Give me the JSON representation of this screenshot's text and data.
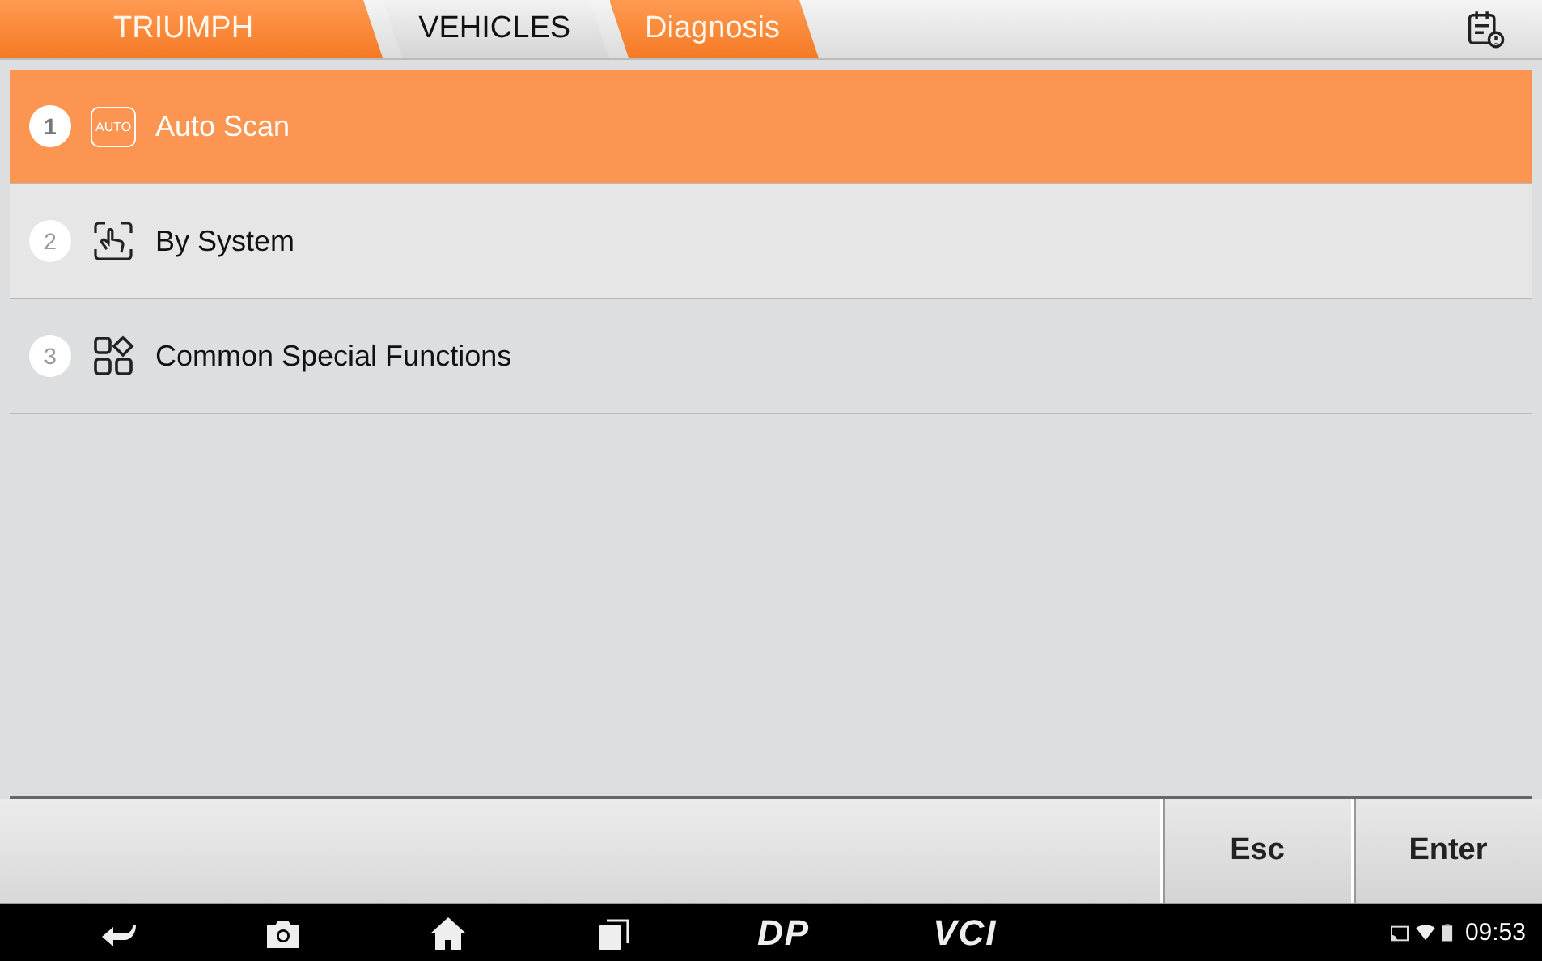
{
  "breadcrumbs": [
    {
      "label": "TRIUMPH",
      "highlighted": true
    },
    {
      "label": "VEHICLES",
      "highlighted": false
    },
    {
      "label": "Diagnosis",
      "highlighted": true
    }
  ],
  "menu": [
    {
      "number": "1",
      "kind": "auto",
      "icon_text": "AUTO",
      "label": "Auto Scan",
      "selected": true
    },
    {
      "number": "2",
      "kind": "touch",
      "label": "By System",
      "selected": false
    },
    {
      "number": "3",
      "kind": "grid",
      "label": "Common Special Functions",
      "selected": false
    }
  ],
  "buttons": [
    "Esc",
    "Enter"
  ],
  "nav_bar": {
    "items": [
      {
        "kind": "back"
      },
      {
        "kind": "camera"
      },
      {
        "kind": "home"
      },
      {
        "kind": "recents"
      },
      {
        "kind": "text",
        "label": "DP"
      },
      {
        "kind": "text",
        "label": "VCI"
      }
    ],
    "time": "09:53"
  }
}
